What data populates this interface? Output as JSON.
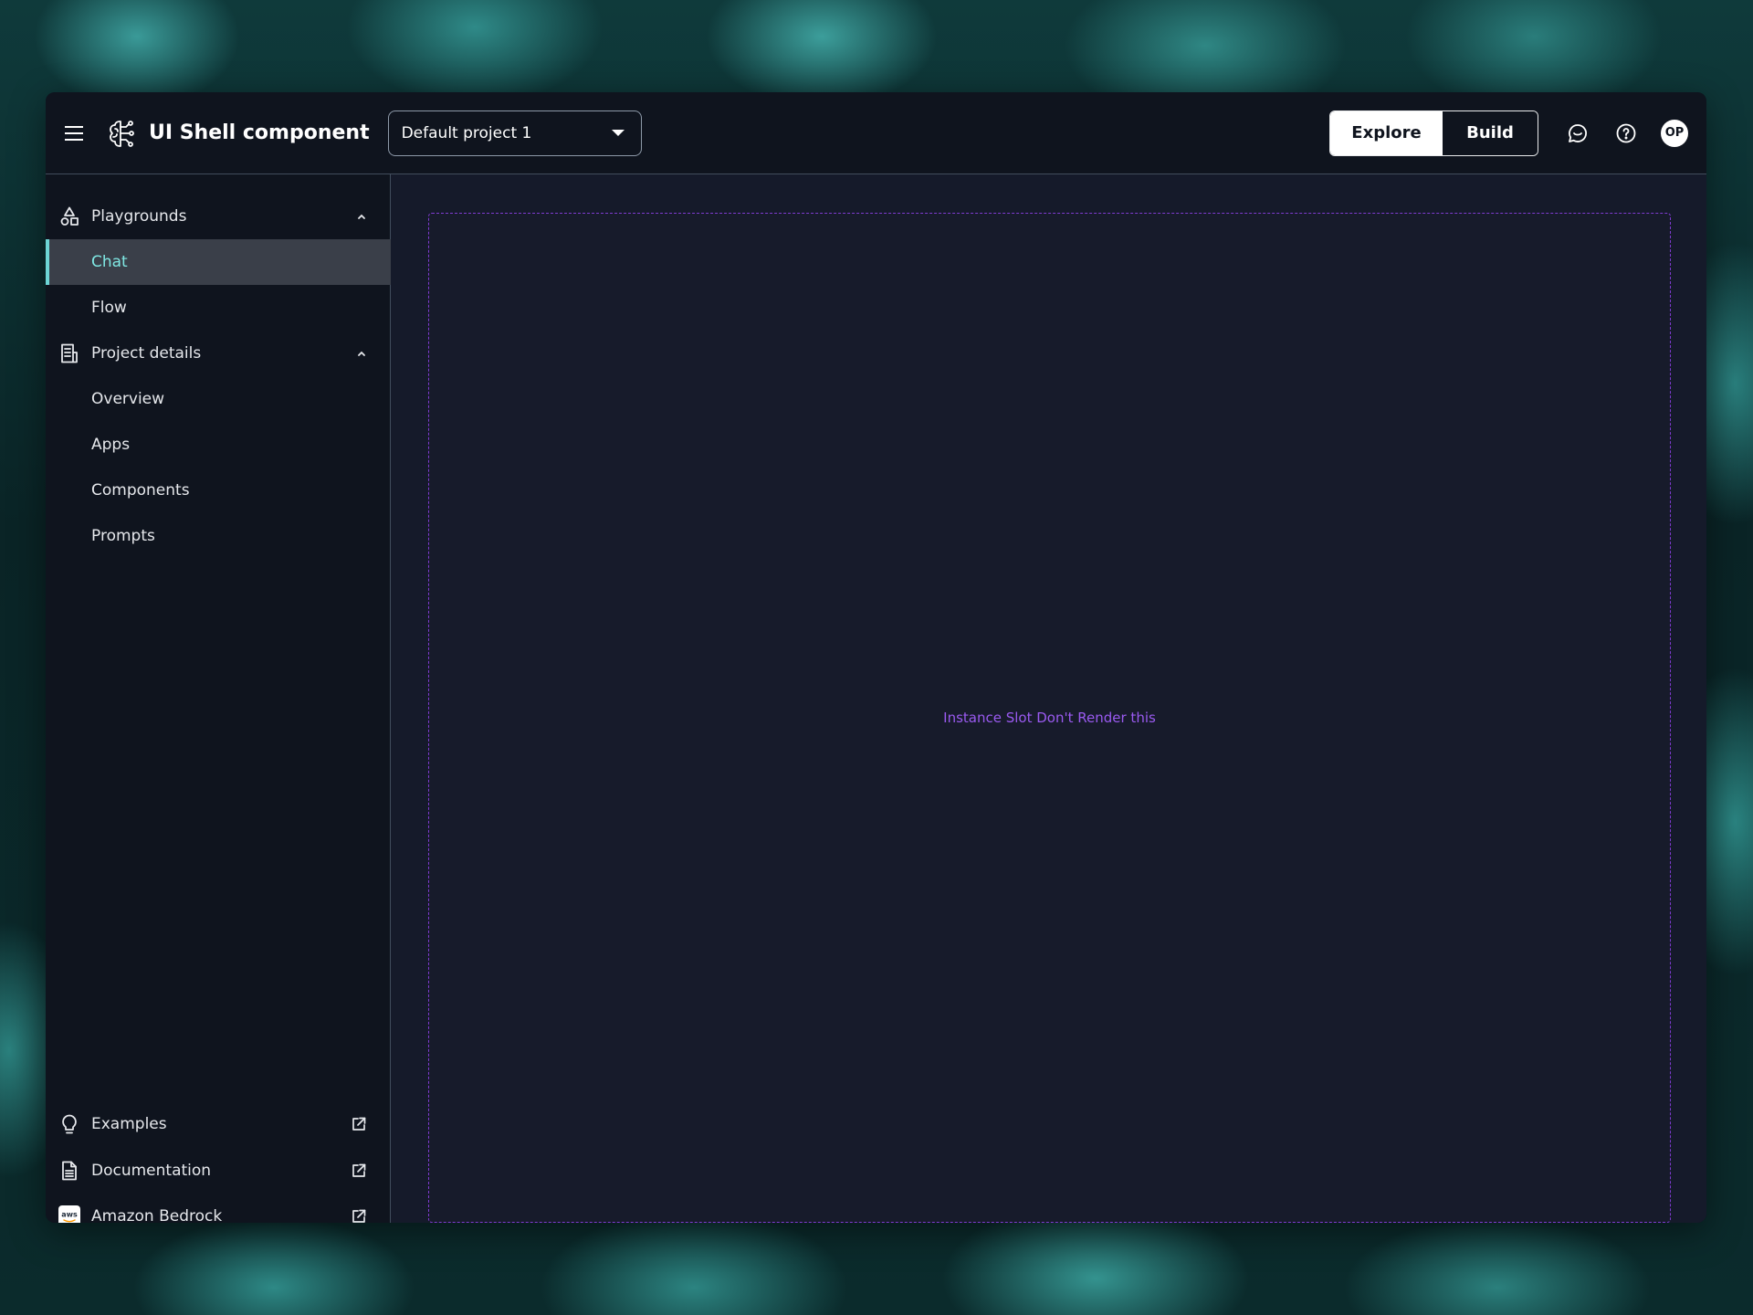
{
  "header": {
    "title": "UI Shell component",
    "project_select": {
      "value": "Default project 1"
    },
    "mode_toggle": {
      "explore_label": "Explore",
      "build_label": "Build",
      "selected": "Explore"
    },
    "avatar_initials": "OP"
  },
  "sidebar": {
    "sections": [
      {
        "label": "Playgrounds",
        "icon": "shapes-icon",
        "expanded": true,
        "items": [
          {
            "label": "Chat",
            "active": true
          },
          {
            "label": "Flow",
            "active": false
          }
        ]
      },
      {
        "label": "Project details",
        "icon": "document-list-icon",
        "expanded": true,
        "items": [
          {
            "label": "Overview"
          },
          {
            "label": "Apps"
          },
          {
            "label": "Components"
          },
          {
            "label": "Prompts"
          }
        ]
      }
    ],
    "footer_links": [
      {
        "label": "Examples",
        "icon": "lightbulb-icon"
      },
      {
        "label": "Documentation",
        "icon": "document-icon"
      },
      {
        "label": "Amazon Bedrock",
        "icon": "aws-icon"
      }
    ]
  },
  "main": {
    "slot_text": "Instance Slot Don't Render this"
  },
  "colors": {
    "accent": "#7fe7e3",
    "slot_border": "#7f3bd1",
    "background": "#0f141e"
  }
}
